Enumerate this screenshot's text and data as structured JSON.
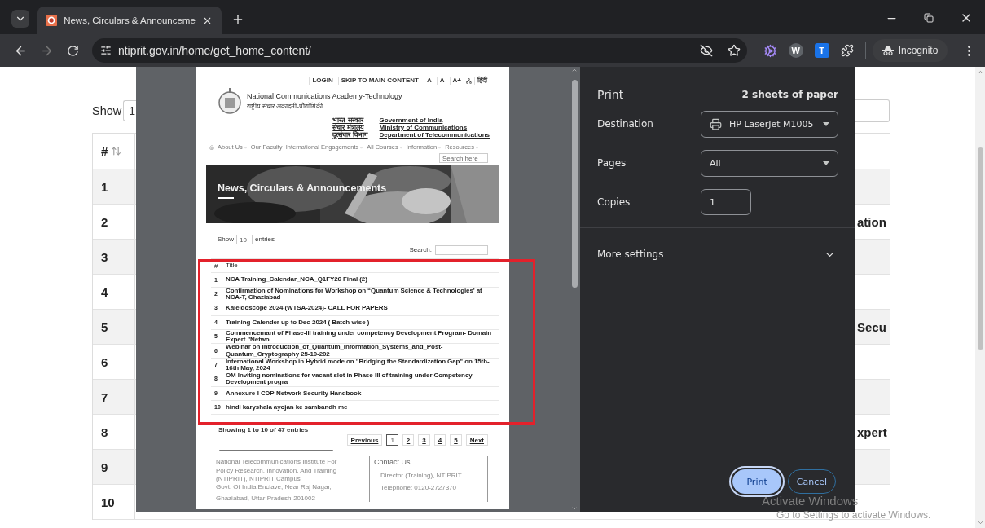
{
  "browser": {
    "tab": {
      "title": "News, Circulars & Announceme",
      "selected": true
    },
    "url": "ntiprit.gov.in/home/get_home_content/",
    "forward_disabled": true,
    "extensions": [
      {
        "kind": "gear"
      },
      {
        "kind": "letter",
        "label": "W"
      },
      {
        "kind": "badge",
        "label": "T"
      },
      {
        "kind": "puzzle"
      }
    ],
    "profile_label": "Incognito"
  },
  "background_page": {
    "show_label": "Show",
    "show_value": "1",
    "header": "#",
    "rows": [
      {
        "number": "1"
      },
      {
        "number": "2",
        "title_fragment": "ation"
      },
      {
        "number": "3"
      },
      {
        "number": "4"
      },
      {
        "number": "5",
        "title_fragment": "Secu"
      },
      {
        "number": "6"
      },
      {
        "number": "7"
      },
      {
        "number": "8",
        "title_fragment": "xpert"
      },
      {
        "number": "9"
      },
      {
        "number": "10"
      }
    ]
  },
  "print_preview": {
    "header_links": [
      "LOGIN",
      "SKIP TO MAIN CONTENT",
      "A",
      "A",
      "A+",
      "हिंदी"
    ],
    "site_name": "National Communications Academy-Technology",
    "site_name_hindi": "राष्ट्रीय संचार अकादमी-प्रौद्योगिकी",
    "government": [
      {
        "hindi": "भारत सरकार",
        "english": "Government of India"
      },
      {
        "hindi": "संचार मंत्रालय",
        "english": "Ministry of Communications"
      },
      {
        "hindi": "दूरसंचार विभाग",
        "english": "Department of Telecommunications"
      }
    ],
    "nav": [
      {
        "label": "About Us",
        "has_menu": true
      },
      {
        "label": "Our Faculty",
        "has_menu": false
      },
      {
        "label": "International Engagements",
        "has_menu": true
      },
      {
        "label": "All Courses",
        "has_menu": true
      },
      {
        "label": "Information",
        "has_menu": true
      },
      {
        "label": "Resources",
        "has_menu": true
      }
    ],
    "search_placeholder": "Search here",
    "banner_title": "News, Circulars & Announcements",
    "show_label": "Show",
    "show_value": "10",
    "entries_label": "entries",
    "search_label": "Search:",
    "columns": [
      "#",
      "Title"
    ],
    "rows": [
      {
        "number": "1",
        "title": "NCA Training_Calendar_NCA_Q1FY26 Final (2)"
      },
      {
        "number": "2",
        "title": "Confirmation of Nominations for Workshop on “Quantum Science & Technologies' at NCA-T, Ghaziabad"
      },
      {
        "number": "3",
        "title": "Kaleidoscope 2024 (WTSA-2024)- CALL FOR PAPERS"
      },
      {
        "number": "4",
        "title": "Training Calender up to Dec-2024 ( Batch-wise )"
      },
      {
        "number": "5",
        "title": "Commencemant of Phase-III training under competency Development Program- Domain Expert \"Netwo"
      },
      {
        "number": "6",
        "title": "Webinar on Introduction_of_Quantum_Information_Systems_and_Post-Quantum_Cryptography 25-10-202"
      },
      {
        "number": "7",
        "title": "International Workshop in Hybrid mode on \"Bridging the Standardization Gap\" on 15th- 16th May, 2024"
      },
      {
        "number": "8",
        "title": "OM Inviting nominations for vacant slot in Phase-III of training under Competency Development progra"
      },
      {
        "number": "9",
        "title": "Annexure-I CDP-Network Security Handbook"
      },
      {
        "number": "10",
        "title": "hindi karyshala ayojan ke sambandh me"
      }
    ],
    "info": "Showing 1 to 10 of 47 entries",
    "pagination": [
      {
        "label": "Previous",
        "selected": false
      },
      {
        "label": "1",
        "selected": true
      },
      {
        "label": "2",
        "selected": false
      },
      {
        "label": "3",
        "selected": false
      },
      {
        "label": "4",
        "selected": false
      },
      {
        "label": "5",
        "selected": false
      },
      {
        "label": "Next",
        "selected": false
      }
    ],
    "footer_address": [
      "National Telecommunications Institute For",
      "Policy Research, Innovation, And Training",
      "(NTIPRIT), NTIPRIT Campus",
      "Govt. Of India Enclave, Near Raj Nagar,",
      "Ghaziabad, Uttar Pradesh-201002"
    ],
    "contact_title": "Contact Us",
    "contact_lines": [
      "Director (Training), NTIPRIT",
      "Telephone: 0120-2727370"
    ]
  },
  "print_dialog": {
    "title": "Print",
    "sheets": "2 sheets of paper",
    "fields": [
      {
        "kind": "printer",
        "label": "Destination",
        "value": "HP LaserJet M1005"
      },
      {
        "kind": "select",
        "label": "Pages",
        "value": "All"
      },
      {
        "kind": "number",
        "label": "Copies",
        "value": "1"
      }
    ],
    "more_settings": {
      "label": "More settings",
      "expanded": false
    },
    "buttons": [
      {
        "kind": "primary",
        "label": "Print"
      },
      {
        "kind": "secondary",
        "label": "Cancel"
      }
    ]
  },
  "os_watermark": {
    "title": "Activate Windows",
    "subtitle": "Go to Settings to activate Windows."
  }
}
